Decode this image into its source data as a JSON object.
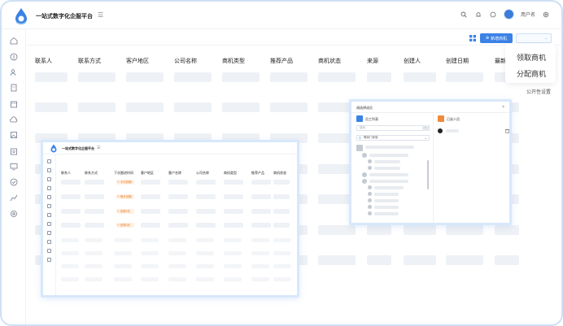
{
  "app": {
    "title": "一站式数字化企服平台",
    "menu_toggle_icon": "menu-fold-icon"
  },
  "header": {
    "user_name": "用户名"
  },
  "toolbar": {
    "new_button": "新增商机",
    "grid_icon": "grid-icon"
  },
  "table": {
    "columns": [
      "联系人",
      "联系方式",
      "客户地区",
      "公司名称",
      "商机类型",
      "推荐产品",
      "商机状态",
      "来源",
      "创建人",
      "创建日期",
      "最新"
    ]
  },
  "actions_menu": {
    "items": [
      "领取商机",
      "分配商机"
    ],
    "settings_label": "公开性设置"
  },
  "preview": {
    "title": "一站式数字化企服平台",
    "columns": [
      "联系人",
      "联系方式",
      "下次跟进时间",
      "客户地区",
      "客户名称",
      "公司名称",
      "商机类型",
      "推荐产品",
      "商机状态"
    ],
    "tags": [
      "今天到期",
      "明天到期",
      "还剩2天",
      "还剩3天"
    ]
  },
  "dialog": {
    "title": "调选择成员",
    "left_title": "员工列表",
    "right_title": "已选人员",
    "search_placeholder": "搜索",
    "department_select": "橡树门体验"
  },
  "colors": {
    "accent": "#3b82e6",
    "tag_bg": "#fff1e4",
    "tag_text": "#e07b22",
    "frame_border": "#cfe0f5",
    "orange_badge": "#f08a3c"
  }
}
